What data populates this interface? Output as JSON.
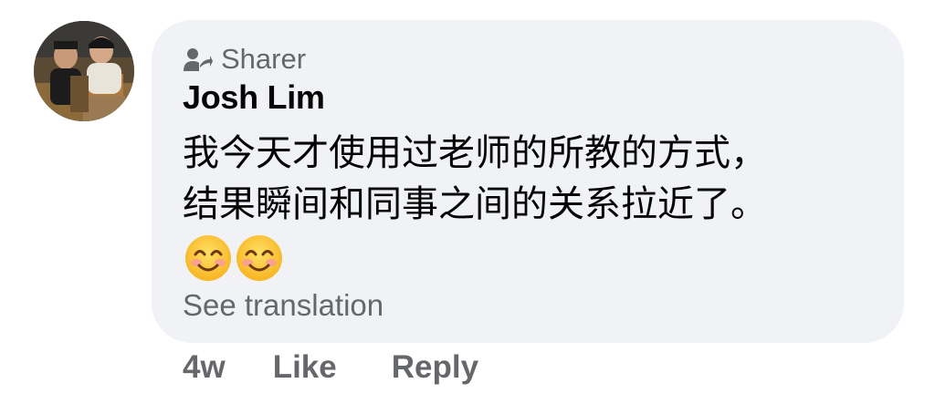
{
  "comment": {
    "badge_label": "Sharer",
    "badge_icon": "sharer-icon",
    "author": "Josh Lim",
    "text_line_1": "我今天才使用过老师的所教的方式，",
    "text_line_2": "结果瞬间和同事之间的关系拉近了。",
    "emojis": [
      "smiling-face-emoji",
      "smiling-face-emoji"
    ],
    "see_translation": "See translation",
    "timestamp": "4w",
    "like_label": "Like",
    "reply_label": "Reply"
  },
  "colors": {
    "bubble_bg": "#f0f2f5",
    "primary_text": "#050505",
    "secondary_text": "#65676b"
  }
}
